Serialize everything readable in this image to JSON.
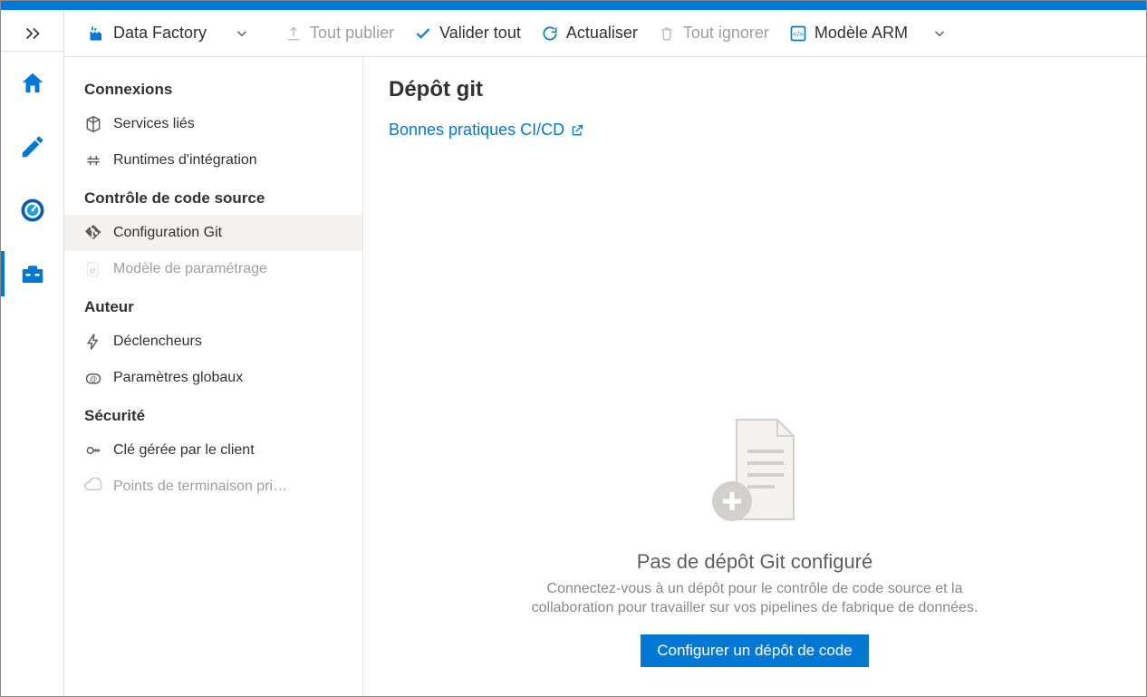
{
  "toolbar": {
    "brand": "Data Factory",
    "publish": "Tout publier",
    "validate": "Valider tout",
    "refresh": "Actualiser",
    "discard": "Tout ignorer",
    "arm": "Modèle ARM"
  },
  "sidebar": {
    "sections": [
      {
        "title": "Connexions",
        "items": [
          {
            "label": "Services liés",
            "icon": "box-icon"
          },
          {
            "label": "Runtimes d'intégration",
            "icon": "integration-icon"
          }
        ]
      },
      {
        "title": "Contrôle de code source",
        "items": [
          {
            "label": "Configuration Git",
            "icon": "git-icon",
            "selected": true
          },
          {
            "label": "Modèle de paramétrage",
            "icon": "param-icon",
            "muted": true
          }
        ]
      },
      {
        "title": "Auteur",
        "items": [
          {
            "label": "Déclencheurs",
            "icon": "trigger-icon"
          },
          {
            "label": "Paramètres globaux",
            "icon": "globals-icon"
          }
        ]
      },
      {
        "title": "Sécurité",
        "items": [
          {
            "label": "Clé gérée par le client",
            "icon": "key-icon"
          },
          {
            "label": "Points de terminaison pri…",
            "icon": "endpoint-icon",
            "muted": true
          }
        ]
      }
    ]
  },
  "page": {
    "title": "Dépôt git",
    "link": "Bonnes pratiques CI/CD",
    "empty_title": "Pas de dépôt Git configuré",
    "empty_desc": "Connectez-vous à un dépôt pour le contrôle de code source et la collaboration pour travailler sur vos pipelines de fabrique de données.",
    "cta": "Configurer un dépôt de code"
  }
}
